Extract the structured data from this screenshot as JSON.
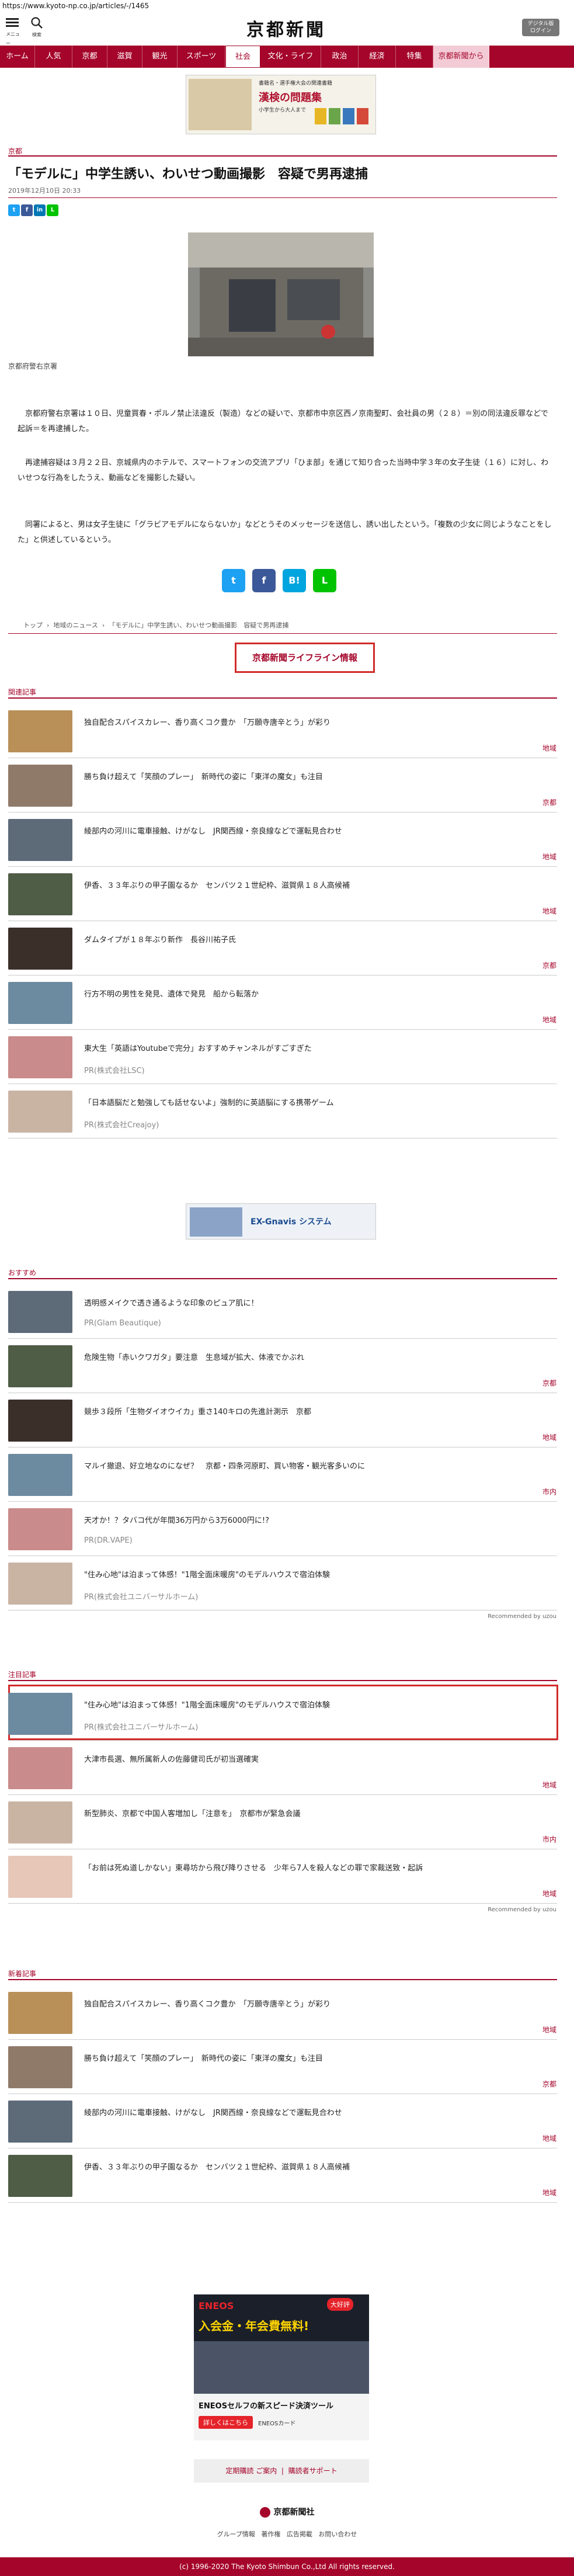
{
  "url": "https://www.kyoto-np.co.jp/articles/-/1465",
  "header": {
    "menu_label": "メニュー",
    "search_label": "検索",
    "logo_text": "京都新聞",
    "digital_btn": "デジタル版\nログイン"
  },
  "nav": [
    "ホーム",
    "人気",
    "京都",
    "滋賀",
    "観光",
    "スポーツ",
    "社会",
    "文化・ライフ",
    "政治",
    "経済",
    "特集",
    "京都新聞から"
  ],
  "ad_top": {
    "line1": "書籍名・選手権大会の関連書籍",
    "line2": "漢検の問題集",
    "line3": "小学生から大人まで"
  },
  "article": {
    "category": "京都",
    "title": "「モデルに」中学生誘い、わいせつ動画撮影　容疑で男再逮捕",
    "date": "2019年12月10日 20:33",
    "caption": "京都府警右京署",
    "paragraphs": [
      "京都府警右京署は１０日、児童買春・ポルノ禁止法違反（製造）などの疑いで、京都市中京区西ノ京南聖町、会社員の男（２８）＝別の同法違反罪などで起訴＝を再逮捕した。",
      "再逮捕容疑は３月２２日、京城県内のホテルで、スマートフォンの交流アプリ「ひま部」を通じて知り合った当時中学３年の女子生徒（１６）に対し、わいせつな行為をしたうえ、動画などを撮影した疑い。",
      "同署によると、男は女子生徒に「グラビアモデルにならないか」などとうそのメッセージを送信し、誘い出したという。「複数の少女に同じようなことをした」と供述しているという。"
    ]
  },
  "breadcrumb": [
    "トップ",
    "地域のニュース",
    "「モデルに」中学生誘い、わいせつ動画撮影　容疑で男再逮捕"
  ],
  "lifeline": "京都新聞ライフライン情報",
  "related": {
    "label": "関連記事",
    "items": [
      {
        "title": "独自配合スパイスカレー、香り高くコク豊か　「万願寺唐辛とう」が彩り",
        "cat": "地域"
      },
      {
        "title": "勝ち負け超えて「笑顔のプレー」　新時代の姿に「東洋の魔女」も注目",
        "cat": "京都"
      },
      {
        "title": "綾部内の河川に電車接触、けがなし　JR関西線・奈良線などで運転見合わせ",
        "cat": "地域"
      },
      {
        "title": "伊香、３３年ぶりの甲子園なるか　センバツ２１世紀枠、滋賀県１８人高候補",
        "cat": "地域"
      },
      {
        "title": "ダムタイプが１８年ぶり新作　長谷川祐子氏",
        "cat": "京都"
      },
      {
        "title": "行方不明の男性を発見、遺体で発見　船から転落か",
        "cat": "地域"
      },
      {
        "title": "東大生「英語はYoutubeで完分」おすすめチャンネルがすごすぎた",
        "pr": "PR(株式会社LSC)"
      },
      {
        "title": "「日本語脳だと勉強しても話せないよ」強制的に英語脳にする携帯ゲーム",
        "pr": "PR(株式会社Creajoy)"
      }
    ]
  },
  "ad_mid": {
    "brand": "EX-Gnavis システム"
  },
  "osusume": {
    "label": "おすすめ",
    "items": [
      {
        "title": "透明感メイクで透き通るような印象のピュア肌に！",
        "pr": "PR(Glam Beautique)"
      },
      {
        "title": "危険生物「赤いクワガタ」要注意　生息域が拡大、体液でかぶれ",
        "cat": "京都"
      },
      {
        "title": "競歩３段所「生物ダイオウイカ」重さ140キロの先進計測示　京都",
        "cat": "地域"
      },
      {
        "title": "マルイ撤退、好立地なのになぜ？　京都・四条河原町、買い物客・観光客多いのに",
        "cat": "市内"
      },
      {
        "title": "天才か！？タバコ代が年間36万円から3万6000円に!?",
        "pr": "PR(DR.VAPE)"
      },
      {
        "title": "\"住み心地\"は泊まって体感！\"1階全面床暖房\"のモデルハウスで宿泊体験",
        "pr": "PR(株式会社ユニバーサルホーム)"
      }
    ],
    "recommended": "Recommended by uzou"
  },
  "chumoku": {
    "label": "注目記事",
    "items": [
      {
        "title": "\"住み心地\"は泊まって体感！\"1階全面床暖房\"のモデルハウスで宿泊体験",
        "pr": "PR(株式会社ユニバーサルホーム)"
      },
      {
        "title": "大津市長選、無所属新人の佐藤健司氏が初当選確実",
        "cat": "地域"
      },
      {
        "title": "新型肺炎、京都で中国人客増加し「注意を」　京都市が緊急会議",
        "cat": "市内"
      },
      {
        "title": "「お前は死ぬ道しかない」東尋坊から飛び降りさせる　少年ら7人を殺人などの罪で家裁送致・起訴",
        "cat": "地域"
      }
    ],
    "recommended": "Recommended by uzou"
  },
  "shinchaku": {
    "label": "新着記事",
    "items": [
      {
        "title": "独自配合スパイスカレー、香り高くコク豊か　「万願寺唐辛とう」が彩り",
        "cat": "地域"
      },
      {
        "title": "勝ち負け超えて「笑顔のプレー」　新時代の姿に「東洋の魔女」も注目",
        "cat": "京都"
      },
      {
        "title": "綾部内の河川に電車接触、けがなし　JR関西線・奈良線などで運転見合わせ",
        "cat": "地域"
      },
      {
        "title": "伊香、３３年ぶりの甲子園なるか　センバツ２１世紀枠、滋賀県１８人高候補",
        "cat": "地域"
      }
    ]
  },
  "ad_bottom": {
    "brand": "ENEOS",
    "tag": "入会金・年会費無料!",
    "product": "ENEOSセルフの新スピード決済ツール",
    "btn": "詳しくはこちら",
    "sub": "ENEOSカード",
    "badge": "大好評"
  },
  "footer_btns": [
    "定期購読 ご案内",
    "購読者サポート"
  ],
  "footer_logo": "京都新聞社",
  "footer_links": [
    "グループ情報",
    "著作権",
    "広告掲載",
    "お問い合わせ"
  ],
  "copyright": "(c) 1996-2020 The Kyoto Shimbun Co.,Ltd All rights reserved."
}
